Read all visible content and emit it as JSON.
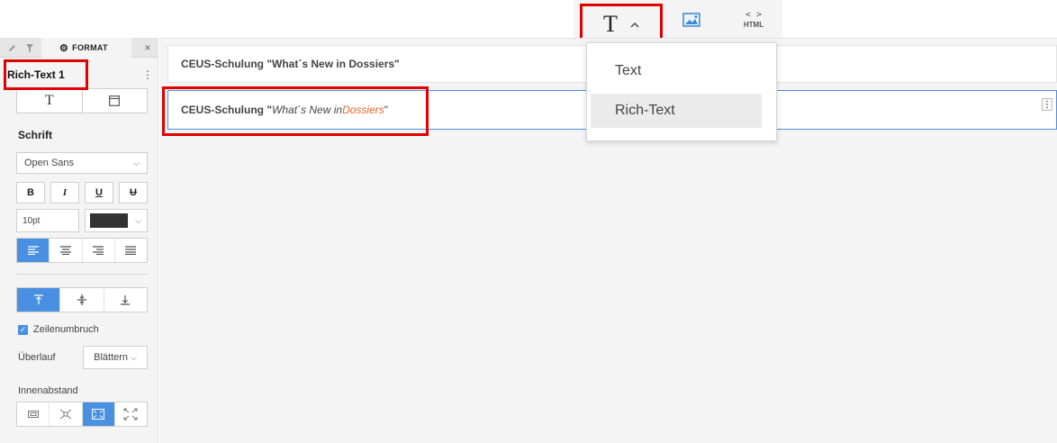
{
  "toolbar": {
    "text_glyph": "T",
    "html_code": "< >",
    "html_label": "HTML"
  },
  "dropdown": {
    "items": [
      "Text",
      "Rich-Text"
    ]
  },
  "panel": {
    "tab_format": "FORMAT",
    "object_title": "Rich-Text 1",
    "type_text_glyph": "T",
    "font_section": "Schrift",
    "font_family": "Open Sans",
    "style_buttons": [
      "B",
      "I",
      "U",
      "U"
    ],
    "font_size": "10pt",
    "text_color": "#333333",
    "wrap_label": "Zeilenumbruch",
    "overflow_label": "Überlauf",
    "overflow_value": "Blättern",
    "padding_label": "Innenabstand"
  },
  "canvas": {
    "block1_text": "CEUS-Schulung \"What´s New in Dossiers\"",
    "block2_prefix": "CEUS-Schulung \"",
    "block2_italic": "What´s New in ",
    "block2_orange": "Dossiers",
    "block2_suffix": "\""
  },
  "colors": {
    "accent": "#4a90e2",
    "highlight_box": "#e00000",
    "rich_text_orange": "#e8632a"
  }
}
